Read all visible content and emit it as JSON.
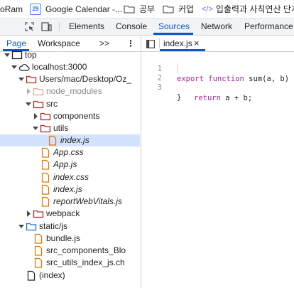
{
  "bookmarks": {
    "items": [
      {
        "label": "oRam"
      },
      {
        "label": "Google Calendar -..."
      },
      {
        "label": "공부"
      },
      {
        "label": "커업"
      },
      {
        "label": "입출력과 사칙연산 단계"
      }
    ],
    "calendar_icon_text": "29",
    "code_icon_text": "</>"
  },
  "devtools": {
    "tabs": [
      "Elements",
      "Console",
      "Sources",
      "Network",
      "Performance"
    ],
    "active_tab": "Sources",
    "accent_color": "#0b57d0"
  },
  "navigator": {
    "tabs": [
      "Page",
      "Workspace"
    ],
    "more_label": ">>",
    "menu_label": "⋮",
    "tree": [
      {
        "label": "top",
        "icon": "frame-icon",
        "expanded": true
      },
      {
        "label": "localhost:3000",
        "icon": "cloud-icon",
        "expanded": true
      },
      {
        "label": "Users/mac/Desktop/Oz_",
        "icon": "folder-icon",
        "expanded": true
      },
      {
        "label": "node_modules",
        "icon": "folder-icon",
        "expanded": false
      },
      {
        "label": "src",
        "icon": "folder-icon",
        "expanded": true
      },
      {
        "label": "components",
        "icon": "folder-icon",
        "expanded": false
      },
      {
        "label": "utils",
        "icon": "folder-icon",
        "expanded": true
      },
      {
        "label": "index.js",
        "icon": "file-icon",
        "selected": true
      },
      {
        "label": "App.css",
        "icon": "file-icon"
      },
      {
        "label": "App.js",
        "icon": "file-icon"
      },
      {
        "label": "index.css",
        "icon": "file-icon"
      },
      {
        "label": "index.js",
        "icon": "file-icon"
      },
      {
        "label": "reportWebVitals.js",
        "icon": "file-icon"
      },
      {
        "label": "webpack",
        "icon": "folder-icon",
        "expanded": false
      },
      {
        "label": "static/js",
        "icon": "folder-icon",
        "expanded": true
      },
      {
        "label": "bundle.js",
        "icon": "file-icon"
      },
      {
        "label": "src_components_Blo",
        "icon": "file-icon"
      },
      {
        "label": "src_utils_index_js.ch",
        "icon": "file-icon"
      },
      {
        "label": "(index)",
        "icon": "file-icon"
      }
    ]
  },
  "editor": {
    "open_tab": "index.js",
    "close_label": "×",
    "lines": [
      {
        "number": "1",
        "keyword1": "export",
        "keyword2": "function",
        "rest": " sum(a, b) {"
      },
      {
        "number": "2",
        "keyword1": "return",
        "rest": " a + b;"
      },
      {
        "number": "3",
        "rest": "}"
      }
    ]
  }
}
